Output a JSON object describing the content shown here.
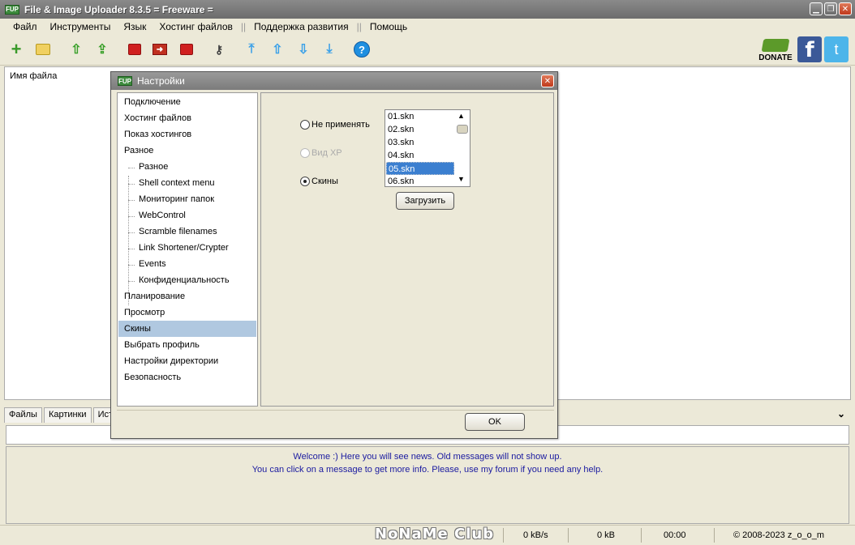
{
  "window": {
    "title": "File & Image Uploader 8.3.5  = Freeware =",
    "icon_text": "FUP"
  },
  "menu": [
    {
      "label": "Файл"
    },
    {
      "label": "Инструменты"
    },
    {
      "label": "Язык"
    },
    {
      "label": "Хостинг файлов"
    },
    {
      "label": "Поддержка развития"
    },
    {
      "label": "Помощь"
    }
  ],
  "menu_separator": "||",
  "toolbar": {
    "donate_label": "DONATE",
    "facebook_glyph": "f",
    "twitter_glyph": "t",
    "help_glyph": "?"
  },
  "filelist": {
    "column_header": "Имя файла"
  },
  "bottom_tabs": [
    {
      "label": "Файлы"
    },
    {
      "label": "Картинки"
    },
    {
      "label": "Ист"
    }
  ],
  "news": {
    "line1": "Welcome :) Here you will see news. Old messages will not show up.",
    "line2": "You can click on a message to get more info. Please, use my forum if you need any help."
  },
  "status": {
    "watermark": "NoNaMe Club",
    "speed": "0 kB/s",
    "size": "0 kB",
    "time": "00:00",
    "copyright": "© 2008-2023 z_o_o_m"
  },
  "dialog": {
    "title": "Настройки",
    "nav": [
      {
        "label": "Подключение",
        "child": false
      },
      {
        "label": "Хостинг файлов",
        "child": false
      },
      {
        "label": "Показ хостингов",
        "child": false
      },
      {
        "label": "Разное",
        "child": false
      },
      {
        "label": "Разное",
        "child": true
      },
      {
        "label": "Shell context menu",
        "child": true
      },
      {
        "label": "Мониторинг папок",
        "child": true
      },
      {
        "label": "WebControl",
        "child": true
      },
      {
        "label": "Scramble filenames",
        "child": true
      },
      {
        "label": "Link Shortener/Crypter",
        "child": true
      },
      {
        "label": "Events",
        "child": true
      },
      {
        "label": "Конфиденциальность",
        "child": true
      },
      {
        "label": "Планирование",
        "child": false
      },
      {
        "label": "Просмотр",
        "child": false
      },
      {
        "label": "Скины",
        "child": false,
        "selected": true
      },
      {
        "label": "Выбрать профиль",
        "child": false
      },
      {
        "label": "Настройки директории",
        "child": false
      },
      {
        "label": "Безопасность",
        "child": false
      }
    ],
    "skins": {
      "option_none": "Не применять",
      "option_xp": "Вид XP",
      "option_skins": "Скины",
      "selected_option": "Скины",
      "skin_files": [
        "01.skn",
        "02.skn",
        "03.skn",
        "04.skn",
        "05.skn",
        "06.skn"
      ],
      "selected_skin": "05.skn",
      "load_button": "Загрузить"
    },
    "ok_button": "OK"
  }
}
